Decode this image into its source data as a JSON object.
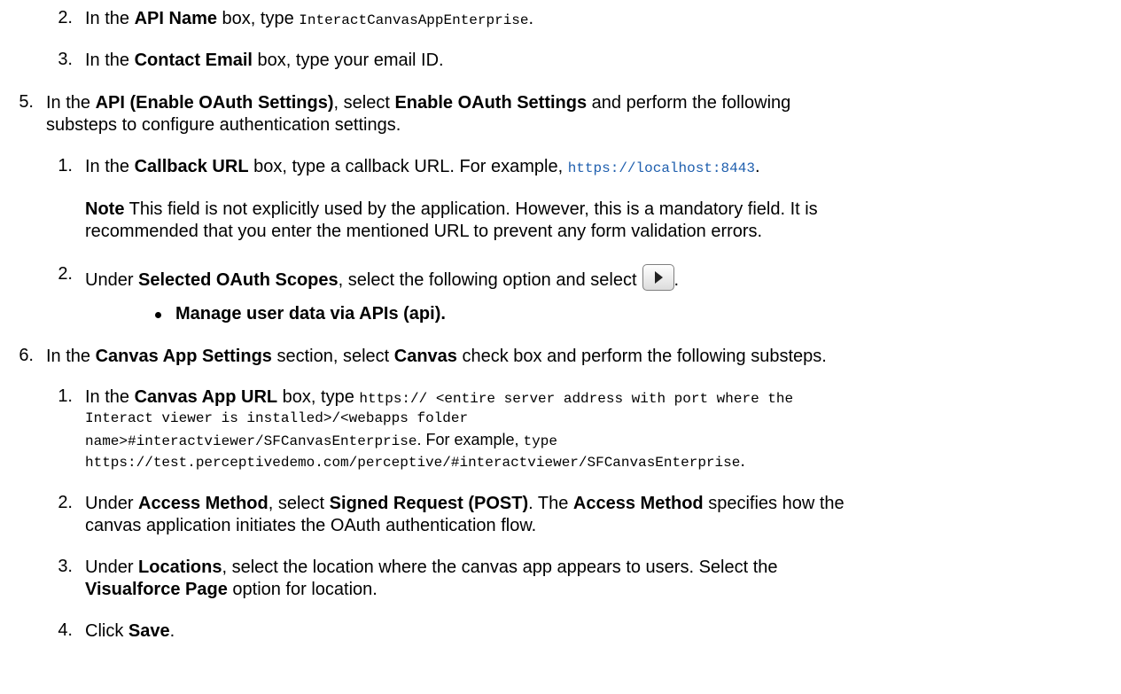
{
  "doc": {
    "s2_2": {
      "num": "2.",
      "pre": "In the ",
      "b1": "API Name",
      "mid": " box, type ",
      "code": "InteractCanvasAppEnterprise",
      "end": "."
    },
    "s2_3": {
      "num": "3.",
      "pre": "In the ",
      "b1": "Contact Email",
      "end": " box, type your email ID."
    },
    "s5": {
      "num": "5.",
      "pre": "In the ",
      "b1": "API (Enable OAuth Settings)",
      "mid": ", select ",
      "b2": "Enable OAuth Settings",
      "end": " and perform the following",
      "line2": "substeps to configure authentication settings."
    },
    "s5_1": {
      "num": "1.",
      "pre": "In the ",
      "b1": "Callback URL",
      "mid": " box, type a callback URL. For example, ",
      "link": "https://localhost:8443",
      "end": "."
    },
    "note": {
      "b1": "Note",
      "line1": " This field is not explicitly used by the application. However, this is a mandatory field. It is",
      "line2": "recommended that you enter the mentioned URL to prevent any form validation errors."
    },
    "s5_2": {
      "num": "2.",
      "pre": "Under ",
      "b1": "Selected OAuth Scopes",
      "end": ", select the following option and select",
      "dot": "."
    },
    "bullet": {
      "text": "Manage user data via APIs (api)."
    },
    "s6": {
      "num": "6.",
      "pre": "In the ",
      "b1": "Canvas App Settings",
      "mid": " section, select ",
      "b2": "Canvas",
      "end": " check box and perform the following substeps."
    },
    "s6_1": {
      "num": "1.",
      "pre": "In the ",
      "b1": "Canvas App URL",
      "mid": " box, type ",
      "code1": "https:// <entire server address with port where the",
      "code2": "Interact viewer is installed>/<webapps folder",
      "code3": "name>#interactviewer/SFCanvasEnterprise",
      "mid2": ". For example, ",
      "code4": "type",
      "code5": "https://test.perceptivedemo.com/perceptive/#interactviewer/SFCanvasEnterprise",
      "end": "."
    },
    "s6_2": {
      "num": "2.",
      "pre": "Under ",
      "b1": "Access Method",
      "mid": ", select ",
      "b2": "Signed Request (POST)",
      "mid2": ". The ",
      "b3": "Access Method",
      "end": " specifies how the",
      "line2": "canvas application initiates the OAuth authentication flow."
    },
    "s6_3": {
      "num": "3.",
      "pre": "Under ",
      "b1": "Locations",
      "end": ", select the location where the canvas app appears to users. Select the",
      "b2": "Visualforce Page",
      "line2": " option for location."
    },
    "s6_4": {
      "num": "4.",
      "pre": "Click ",
      "b1": "Save",
      "end": "."
    }
  }
}
